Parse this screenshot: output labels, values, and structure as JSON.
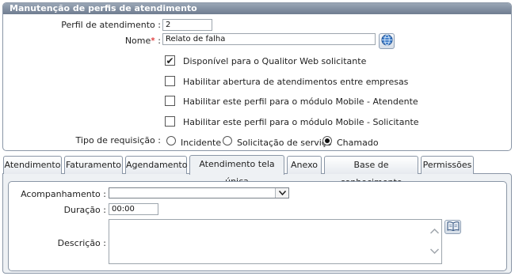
{
  "panel": {
    "title": "Manutenção de perfis de atendimento"
  },
  "form": {
    "perfil_label": "Perfil de atendimento :",
    "perfil_value": "2",
    "nome_label": "Nome",
    "nome_required": "*",
    "nome_colon": ":",
    "nome_value": "Relato de falha",
    "checkboxes": [
      {
        "label": "Disponível para o Qualitor Web solicitante",
        "checked": true,
        "check_glyph": "✔"
      },
      {
        "label": "Habilitar abertura de atendimentos entre empresas",
        "checked": false,
        "check_glyph": ""
      },
      {
        "label": "Habilitar este perfil para o módulo Mobile - Atendente",
        "checked": false,
        "check_glyph": ""
      },
      {
        "label": "Habilitar este perfil para o módulo Mobile - Solicitante",
        "checked": false,
        "check_glyph": ""
      }
    ],
    "tipo_label": "Tipo de requisição :",
    "tipo_options": [
      {
        "label": "Incidente",
        "selected": false
      },
      {
        "label": "Solicitação de serviço",
        "selected": false
      },
      {
        "label": "Chamado",
        "selected": true
      }
    ]
  },
  "tabs": [
    {
      "label": "Atendimento",
      "active": false
    },
    {
      "label": "Faturamento",
      "active": false
    },
    {
      "label": "Agendamento",
      "active": false
    },
    {
      "label": "Atendimento tela única",
      "active": true
    },
    {
      "label": "Anexo",
      "active": false
    },
    {
      "label": "Base de conhecimento",
      "active": false
    },
    {
      "label": "Permissões",
      "active": false
    }
  ],
  "tab_content": {
    "acompanhamento_label": "Acompanhamento :",
    "acompanhamento_value": "",
    "duracao_label": "Duração :",
    "duracao_value": "00:00",
    "descricao_label": "Descrição :",
    "descricao_value": ""
  }
}
